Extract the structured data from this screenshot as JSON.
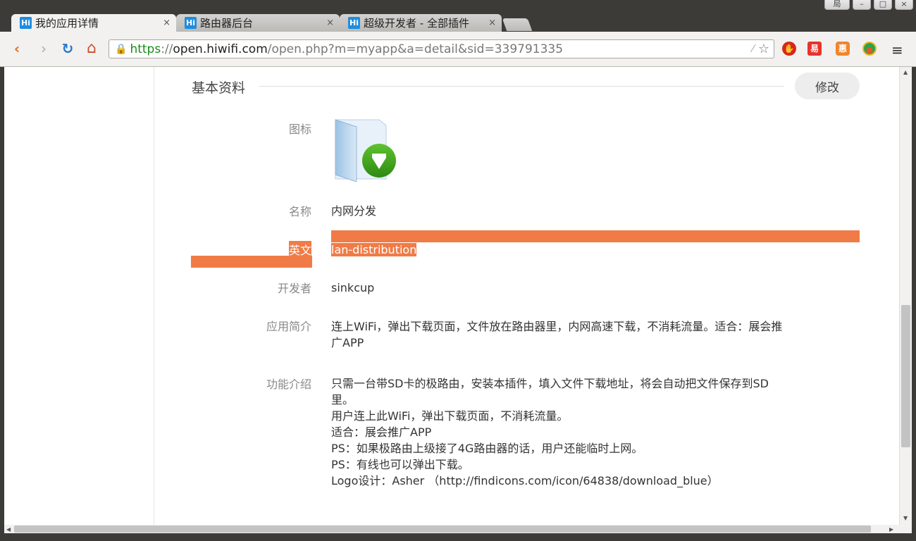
{
  "window": {
    "controls": [
      "局",
      "–",
      "□",
      "×"
    ]
  },
  "tabs": [
    {
      "icon": "Hi",
      "title": "我的应用详情",
      "close": "×",
      "active": true
    },
    {
      "icon": "Hi",
      "title": "路由器后台",
      "close": "×",
      "active": false
    },
    {
      "icon": "Hi",
      "title": "超级开发者 - 全部插件",
      "close": "×",
      "active": false
    }
  ],
  "toolbar": {
    "back": "‹",
    "forward": "›",
    "reload": "↻",
    "home": "⌂",
    "url": {
      "scheme": "https",
      "sep": "://",
      "host": "open.hiwifi.com",
      "path": "/open.php?m=myapp&a=detail&sid=339791335"
    },
    "star": "☆",
    "menu": "≡"
  },
  "extensions": [
    {
      "name": "adblock-icon",
      "glyph": "✋",
      "color": "#d9261c"
    },
    {
      "name": "extension-red-icon",
      "glyph": "易",
      "color": "#e8332b"
    },
    {
      "name": "extension-orange-icon",
      "glyph": "惠",
      "color": "#f0852d"
    },
    {
      "name": "extension-eye-icon",
      "glyph": "●",
      "color": "#e05a2a"
    }
  ],
  "section": {
    "title": "基本资料",
    "edit_label": "修改"
  },
  "fields": {
    "icon_label": "图标",
    "name_label": "名称",
    "name_value": "内网分发",
    "en_label": "英文",
    "en_value": "lan-distribution",
    "dev_label": "开发者",
    "dev_value": "sinkcup",
    "intro_label": "应用简介",
    "intro_line1": "连上WiFi，弹出下载页面，文件放在路由器里，内网高速下载，不消耗流量。适合：展会推",
    "intro_line2": "广APP",
    "feature_label": "功能介绍",
    "feature_lines": [
      "只需一台带SD卡的极路由，安装本插件，填入文件下载地址，将会自动把文件保存到SD",
      "里。",
      "用户连上此WiFi，弹出下载页面，不消耗流量。",
      "适合：展会推广APP",
      "PS：如果极路由上级接了4G路由器的话，用户还能临时上网。",
      "PS：有线也可以弹出下载。",
      "Logo设计：Asher （http://findicons.com/icon/64838/download_blue）"
    ]
  }
}
